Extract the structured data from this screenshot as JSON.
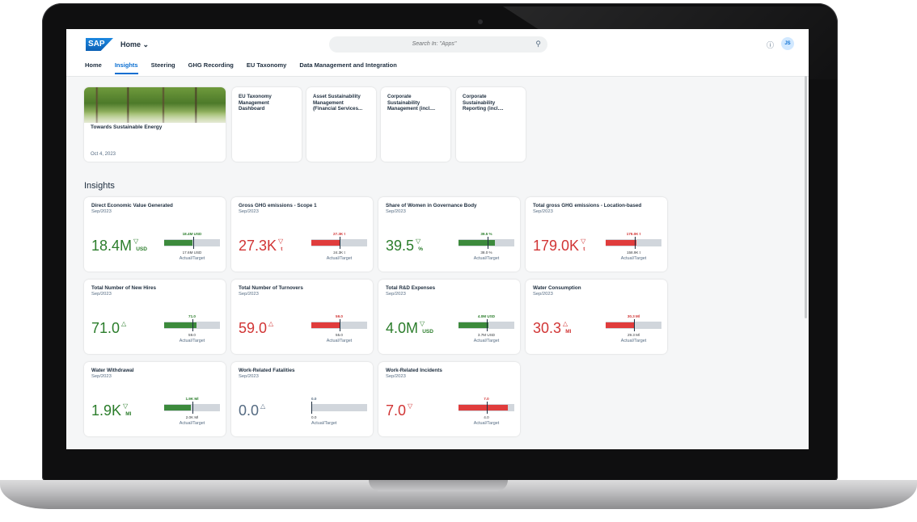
{
  "shell": {
    "logo_text": "SAP",
    "home_menu": "Home ⌄",
    "search_placeholder": "Search In: \"Apps\"",
    "help_icon": "question-circle-icon",
    "avatar_initials": "JS"
  },
  "tabs": [
    "Home",
    "Insights",
    "Steering",
    "GHG Recording",
    "EU Taxonomy",
    "Data Management and Integration"
  ],
  "active_tab": "Insights",
  "news_tile": {
    "title": "Towards Sustainable Energy",
    "date": "Oct 4, 2023"
  },
  "app_tiles": [
    "EU Taxonomy\nManagement\nDashboard",
    "Asset Sustainability\nManagement\n(Financial Services...",
    "Corporate\nSustainability\nManagement (incl....",
    "Corporate\nSustainability\nReporting (incl...."
  ],
  "section_title": "Insights",
  "caption": "Actual/Target",
  "colors": {
    "good": "#2b7d2b",
    "bad": "#d13535",
    "accent": "#0a6ed1"
  },
  "kpis": [
    {
      "title": "Direct Economic Value Generated",
      "period": "Sep/2023",
      "value": "18.4M",
      "unit": "USD",
      "indicator": "▽",
      "status": "good",
      "actual_label": "18.4M USD",
      "target_label": "17.6M USD",
      "fill": 0.5,
      "target": 0.52
    },
    {
      "title": "Gross GHG emissions - Scope 1",
      "period": "Sep/2023",
      "value": "27.3K",
      "unit": "t",
      "indicator": "▽",
      "status": "bad",
      "actual_label": "27.3K t",
      "target_label": "24.3K t",
      "fill": 0.52,
      "target": 0.5
    },
    {
      "title": "Share of Women in Governance Body",
      "period": "Sep/2023",
      "value": "39.5",
      "unit": "%",
      "indicator": "▽",
      "status": "good",
      "actual_label": "39.5 %",
      "target_label": "38.0 %",
      "fill": 0.65,
      "target": 0.52
    },
    {
      "title": "Total gross GHG emissions - Location-based",
      "period": "Sep/2023",
      "value": "179.0K",
      "unit": "t",
      "indicator": "▽",
      "status": "bad",
      "actual_label": "179.0K t",
      "target_label": "158.9K t",
      "fill": 0.55,
      "target": 0.52
    },
    {
      "title": "Total Number of New Hires",
      "period": "Sep/2023",
      "value": "71.0",
      "unit": "",
      "indicator": "△",
      "status": "good",
      "actual_label": "71.0",
      "target_label": "59.0",
      "fill": 0.58,
      "target": 0.5
    },
    {
      "title": "Total Number of Turnovers",
      "period": "Sep/2023",
      "value": "59.0",
      "unit": "",
      "indicator": "△",
      "status": "bad",
      "actual_label": "59.0",
      "target_label": "55.0",
      "fill": 0.52,
      "target": 0.5
    },
    {
      "title": "Total R&D Expenses",
      "period": "Sep/2023",
      "value": "4.0M",
      "unit": "USD",
      "indicator": "▽",
      "status": "good",
      "actual_label": "4.0M USD",
      "target_label": "3.7M USD",
      "fill": 0.54,
      "target": 0.5
    },
    {
      "title": "Water Consumption",
      "period": "Sep/2023",
      "value": "30.3",
      "unit": "Ml",
      "indicator": "△",
      "status": "bad",
      "actual_label": "30.3 Ml",
      "target_label": "29.3 Ml",
      "fill": 0.52,
      "target": 0.5
    },
    {
      "title": "Water Withdrawal",
      "period": "Sep/2023",
      "value": "1.9K",
      "unit": "Ml",
      "indicator": "▽",
      "status": "good",
      "actual_label": "1.9K Ml",
      "target_label": "2.0K Ml",
      "fill": 0.48,
      "target": 0.5
    },
    {
      "title": "Work-Related Fatalities",
      "period": "Sep/2023",
      "value": "0.0",
      "unit": "",
      "indicator": "△",
      "status": "neutral",
      "actual_label": "0.0",
      "target_label": "0.0",
      "fill": 0.0,
      "target": 0.0
    },
    {
      "title": "Work-Related Incidents",
      "period": "Sep/2023",
      "value": "7.0",
      "unit": "",
      "indicator": "▽",
      "status": "bad",
      "actual_label": "7.0",
      "target_label": "4.0",
      "fill": 0.88,
      "target": 0.5
    }
  ]
}
